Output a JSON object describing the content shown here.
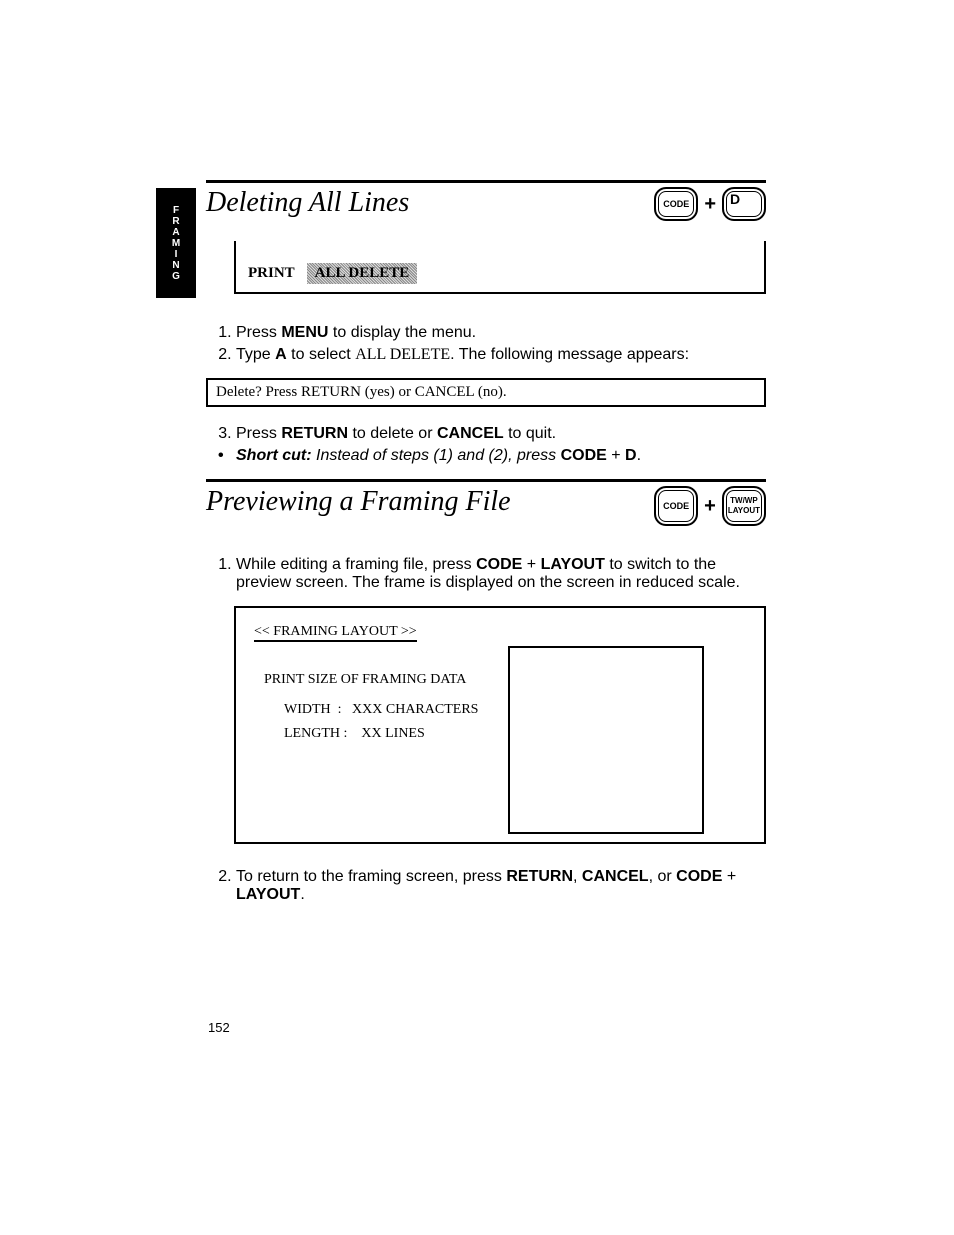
{
  "side_tab": "FRAMING",
  "section1": {
    "title": "Deleting All Lines",
    "key1": "CODE",
    "key2": "D",
    "print_label": "PRINT",
    "print_item": "ALL DELETE",
    "steps": {
      "s1_pre": "Press ",
      "s1_bold": "MENU",
      "s1_post": " to display the menu.",
      "s2_pre": "Type ",
      "s2_bold": "A",
      "s2_mid": " to select ",
      "s2_caps": "ALL DELETE",
      "s2_post": ". The following message appears:"
    },
    "prompt": "Delete?  Press RETURN (yes) or CANCEL (no).",
    "s3": {
      "pre": "Press ",
      "b1": "RETURN",
      "mid": " to delete or ",
      "b2": "CANCEL",
      "post": " to quit."
    },
    "shortcut": {
      "label": "Short cut:",
      "text": "  Instead of steps (1) and (2), press ",
      "b1": "CODE",
      "plus": " + ",
      "b2": "D",
      "period": "."
    }
  },
  "section2": {
    "title": "Previewing a Framing File",
    "key1": "CODE",
    "key2top": "TW/WP",
    "key2bot": "LAYOUT",
    "s1": {
      "pre": "While editing a framing file, press ",
      "b1": "CODE",
      "plus": " + ",
      "b2": "LAYOUT",
      "post": " to switch to the preview screen. The frame is displayed on the screen in reduced scale."
    },
    "layout": {
      "title": "<< FRAMING LAYOUT >>",
      "subtitle": "PRINT SIZE OF FRAMING DATA",
      "width_label": "WIDTH",
      "width_value": "XXX  CHARACTERS",
      "length_label": "LENGTH",
      "length_value": "XX  LINES"
    },
    "s2": {
      "pre": "To return to the framing screen, press ",
      "b1": "RETURN",
      "c1": ", ",
      "b2": "CANCEL",
      "c2": ", or ",
      "b3": "CODE",
      "plus": " + ",
      "b4": "LAYOUT",
      "period": "."
    }
  },
  "page_number": "152"
}
